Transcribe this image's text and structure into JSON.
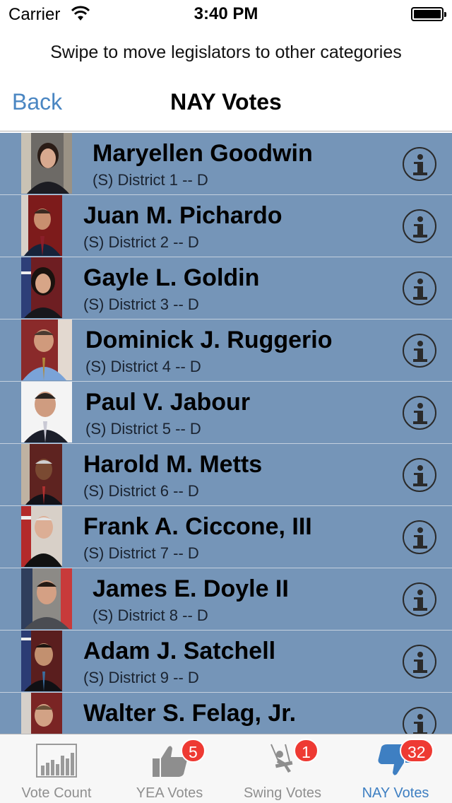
{
  "status_bar": {
    "carrier": "Carrier",
    "time": "3:40 PM"
  },
  "instruction": "Swipe to move legislators to other categories",
  "nav": {
    "back": "Back",
    "title": "NAY Votes"
  },
  "legislators": [
    {
      "name": "Maryellen Goodwin",
      "detail": "(S) District 1 -- D"
    },
    {
      "name": "Juan M. Pichardo",
      "detail": "(S) District 2 -- D"
    },
    {
      "name": "Gayle L. Goldin",
      "detail": "(S) District 3 -- D"
    },
    {
      "name": "Dominick J. Ruggerio",
      "detail": "(S) District 4 -- D"
    },
    {
      "name": "Paul V. Jabour",
      "detail": "(S) District 5 -- D"
    },
    {
      "name": "Harold M. Metts",
      "detail": "(S) District 6 -- D"
    },
    {
      "name": "Frank A. Ciccone, III",
      "detail": "(S) District 7 -- D"
    },
    {
      "name": "James E. Doyle II",
      "detail": "(S) District 8 -- D"
    },
    {
      "name": "Adam J. Satchell",
      "detail": "(S) District 9 -- D"
    },
    {
      "name": "Walter S. Felag, Jr.",
      "detail": ""
    }
  ],
  "tabs": [
    {
      "label": "Vote Count",
      "icon": "bar-chart-icon",
      "badge": ""
    },
    {
      "label": "YEA Votes",
      "icon": "thumbs-up-icon",
      "badge": "5"
    },
    {
      "label": "Swing Votes",
      "icon": "swing-icon",
      "badge": "1"
    },
    {
      "label": "NAY Votes",
      "icon": "thumbs-down-icon",
      "badge": "32"
    }
  ],
  "colors": {
    "row_background": "#7595b8",
    "accent": "#3e7fc2",
    "back_link": "#4a86c2",
    "badge": "#ee3a33"
  }
}
